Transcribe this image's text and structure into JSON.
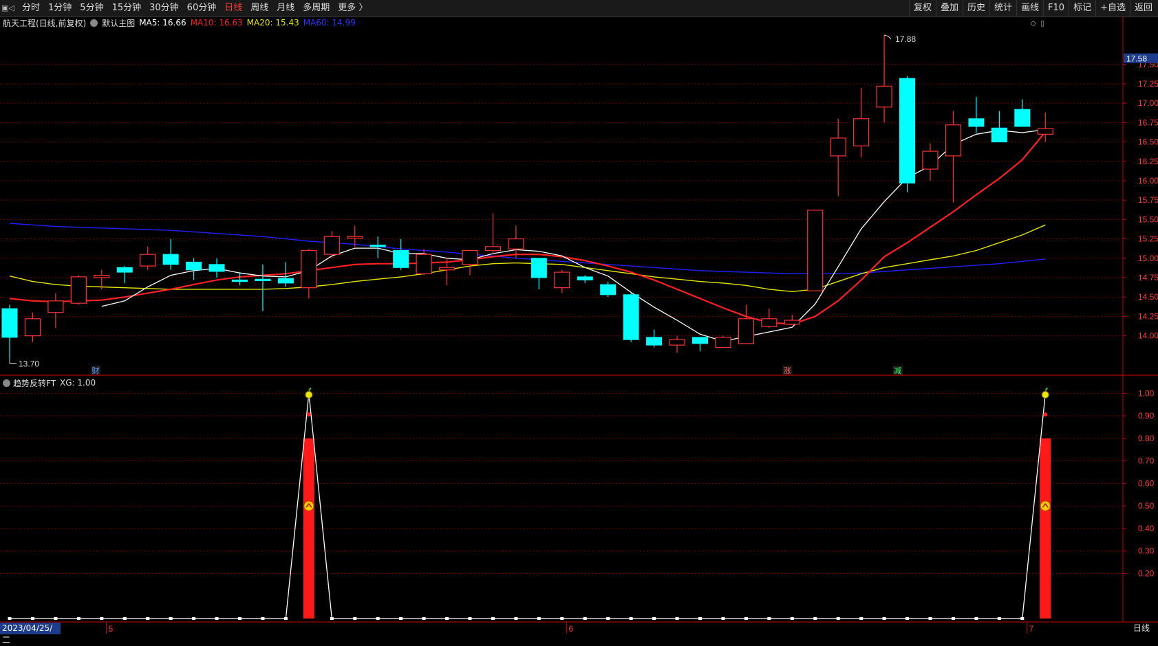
{
  "toolbar": {
    "left_items": [
      "分时",
      "1分钟",
      "5分钟",
      "15分钟",
      "30分钟",
      "60分钟",
      "日线",
      "周线",
      "月线",
      "多周期",
      "更多 〉"
    ],
    "active_index": 6,
    "right_items": [
      "复权",
      "叠加",
      "历史",
      "统计",
      "画线",
      "F10",
      "标记",
      "+自选",
      "返回"
    ]
  },
  "main_chart": {
    "stock_title": "航天工程(日线,前复权)",
    "template_label": "默认主图",
    "ma5": "MA5: 16.66",
    "ma10": "MA10: 16.63",
    "ma20": "MA20: 15.43",
    "ma60": "MA60: 14.99",
    "high_label": "17.88",
    "low_label": "13.70",
    "price_tag": "17.58",
    "marker_cai": "财",
    "marker_zhang": "涨",
    "marker_jian": "减"
  },
  "indicator": {
    "title": "趋势反转FT",
    "xg_value": "XG: 1.00"
  },
  "bottom": {
    "date": "2023/04/25/二",
    "period": "日线",
    "month_ticks": [
      "5",
      "6",
      "7"
    ]
  },
  "colors": {
    "up": "#ff3333",
    "down": "#00ffff",
    "ma5": "#ffffff",
    "ma10": "#ff2020",
    "ma20": "#e6e600",
    "ma60": "#2020ff",
    "grid": "#7a0000",
    "axis": "#c00000",
    "price_tag": "#1e3c8c"
  },
  "chart_data": {
    "type": "candlestick",
    "y_axis_ticks": [
      14.0,
      14.25,
      14.5,
      14.75,
      15.0,
      15.25,
      15.5,
      15.75,
      16.0,
      16.25,
      16.5,
      16.75,
      17.0,
      17.25,
      17.5
    ],
    "ylim": [
      13.5,
      17.95
    ],
    "candles": [
      {
        "o": 14.35,
        "h": 14.4,
        "l": 13.7,
        "c": 13.98
      },
      {
        "o": 14.0,
        "h": 14.3,
        "l": 13.92,
        "c": 14.22
      },
      {
        "o": 14.3,
        "h": 14.55,
        "l": 14.1,
        "c": 14.45
      },
      {
        "o": 14.42,
        "h": 14.78,
        "l": 14.4,
        "c": 14.76
      },
      {
        "o": 14.75,
        "h": 14.85,
        "l": 14.6,
        "c": 14.78
      },
      {
        "o": 14.88,
        "h": 14.9,
        "l": 14.68,
        "c": 14.82
      },
      {
        "o": 14.9,
        "h": 15.15,
        "l": 14.85,
        "c": 15.05
      },
      {
        "o": 15.05,
        "h": 15.25,
        "l": 14.85,
        "c": 14.92
      },
      {
        "o": 14.95,
        "h": 15.0,
        "l": 14.72,
        "c": 14.85
      },
      {
        "o": 14.92,
        "h": 15.0,
        "l": 14.75,
        "c": 14.83
      },
      {
        "o": 14.72,
        "h": 14.82,
        "l": 14.65,
        "c": 14.7
      },
      {
        "o": 14.73,
        "h": 14.92,
        "l": 14.32,
        "c": 14.71
      },
      {
        "o": 14.74,
        "h": 14.95,
        "l": 14.63,
        "c": 14.68
      },
      {
        "o": 14.62,
        "h": 15.12,
        "l": 14.48,
        "c": 15.1
      },
      {
        "o": 15.05,
        "h": 15.35,
        "l": 15.0,
        "c": 15.28
      },
      {
        "o": 15.26,
        "h": 15.42,
        "l": 15.15,
        "c": 15.28
      },
      {
        "o": 15.17,
        "h": 15.28,
        "l": 15.0,
        "c": 15.15
      },
      {
        "o": 15.1,
        "h": 15.25,
        "l": 14.85,
        "c": 14.88
      },
      {
        "o": 14.8,
        "h": 15.12,
        "l": 14.78,
        "c": 15.05
      },
      {
        "o": 14.85,
        "h": 15.0,
        "l": 14.65,
        "c": 14.88
      },
      {
        "o": 14.92,
        "h": 15.1,
        "l": 14.78,
        "c": 15.1
      },
      {
        "o": 15.1,
        "h": 15.58,
        "l": 15.05,
        "c": 15.15
      },
      {
        "o": 15.12,
        "h": 15.42,
        "l": 15.0,
        "c": 15.25
      },
      {
        "o": 15.0,
        "h": 15.0,
        "l": 14.6,
        "c": 14.75
      },
      {
        "o": 14.62,
        "h": 14.85,
        "l": 14.55,
        "c": 14.82
      },
      {
        "o": 14.76,
        "h": 14.78,
        "l": 14.68,
        "c": 14.72
      },
      {
        "o": 14.66,
        "h": 14.7,
        "l": 14.5,
        "c": 14.53
      },
      {
        "o": 14.53,
        "h": 14.55,
        "l": 13.92,
        "c": 13.95
      },
      {
        "o": 13.98,
        "h": 14.08,
        "l": 13.85,
        "c": 13.88
      },
      {
        "o": 13.88,
        "h": 14.0,
        "l": 13.78,
        "c": 13.95
      },
      {
        "o": 13.98,
        "h": 13.98,
        "l": 13.8,
        "c": 13.9
      },
      {
        "o": 13.85,
        "h": 14.0,
        "l": 13.85,
        "c": 13.98
      },
      {
        "o": 13.9,
        "h": 14.4,
        "l": 13.9,
        "c": 14.22
      },
      {
        "o": 14.12,
        "h": 14.35,
        "l": 14.1,
        "c": 14.22
      },
      {
        "o": 14.15,
        "h": 14.27,
        "l": 14.15,
        "c": 14.2
      },
      {
        "o": 14.58,
        "h": 15.62,
        "l": 14.58,
        "c": 15.62
      },
      {
        "o": 16.32,
        "h": 16.8,
        "l": 15.8,
        "c": 16.55
      },
      {
        "o": 16.45,
        "h": 17.2,
        "l": 16.3,
        "c": 16.8
      },
      {
        "o": 16.95,
        "h": 17.88,
        "l": 16.75,
        "c": 17.22
      },
      {
        "o": 17.32,
        "h": 17.35,
        "l": 15.85,
        "c": 15.97
      },
      {
        "o": 16.15,
        "h": 16.48,
        "l": 16.0,
        "c": 16.38
      },
      {
        "o": 16.32,
        "h": 16.9,
        "l": 15.72,
        "c": 16.72
      },
      {
        "o": 16.8,
        "h": 17.08,
        "l": 16.62,
        "c": 16.7
      },
      {
        "o": 16.68,
        "h": 16.9,
        "l": 16.5,
        "c": 16.5
      },
      {
        "o": 16.92,
        "h": 17.05,
        "l": 16.7,
        "c": 16.7
      },
      {
        "o": 16.6,
        "h": 16.88,
        "l": 16.5,
        "c": 16.67
      }
    ],
    "ma5": [
      null,
      null,
      null,
      null,
      14.38,
      14.45,
      14.63,
      14.78,
      14.84,
      14.87,
      14.81,
      14.77,
      14.76,
      14.84,
      15.03,
      15.13,
      15.13,
      15.06,
      15.06,
      15.0,
      14.98,
      15.06,
      15.11,
      15.09,
      15.03,
      14.88,
      14.77,
      14.56,
      14.37,
      14.2,
      14.02,
      13.93,
      13.99,
      14.05,
      14.11,
      14.41,
      14.89,
      15.38,
      15.73,
      16.04,
      16.19,
      16.47,
      16.6,
      16.65,
      16.62,
      16.66
    ],
    "ma10": [
      14.48,
      14.45,
      14.44,
      14.45,
      14.46,
      14.5,
      14.55,
      14.6,
      14.66,
      14.72,
      14.76,
      14.78,
      14.8,
      14.84,
      14.88,
      14.92,
      14.93,
      14.93,
      14.94,
      14.95,
      14.98,
      15.02,
      15.05,
      15.05,
      15.02,
      14.97,
      14.9,
      14.82,
      14.72,
      14.6,
      14.48,
      14.36,
      14.25,
      14.17,
      14.15,
      14.25,
      14.45,
      14.72,
      15.02,
      15.2,
      15.4,
      15.6,
      15.82,
      16.03,
      16.27,
      16.63
    ],
    "ma20": [
      14.77,
      14.7,
      14.66,
      14.64,
      14.63,
      14.62,
      14.61,
      14.6,
      14.6,
      14.6,
      14.6,
      14.6,
      14.61,
      14.63,
      14.66,
      14.7,
      14.73,
      14.76,
      14.8,
      14.85,
      14.9,
      14.93,
      14.94,
      14.93,
      14.92,
      14.88,
      14.84,
      14.8,
      14.76,
      14.73,
      14.7,
      14.68,
      14.65,
      14.6,
      14.57,
      14.6,
      14.7,
      14.8,
      14.88,
      14.93,
      14.98,
      15.03,
      15.1,
      15.2,
      15.3,
      15.43
    ],
    "ma60": [
      15.45,
      15.43,
      15.41,
      15.4,
      15.39,
      15.38,
      15.37,
      15.36,
      15.34,
      15.32,
      15.3,
      15.28,
      15.25,
      15.22,
      15.2,
      15.18,
      15.15,
      15.12,
      15.1,
      15.08,
      15.05,
      15.03,
      15.0,
      14.98,
      14.96,
      14.94,
      14.92,
      14.9,
      14.88,
      14.86,
      14.84,
      14.83,
      14.82,
      14.81,
      14.8,
      14.8,
      14.8,
      14.81,
      14.83,
      14.85,
      14.87,
      14.89,
      14.91,
      14.93,
      14.96,
      14.99
    ],
    "indicator": {
      "y_axis_ticks": [
        0.2,
        0.3,
        0.4,
        0.5,
        0.6,
        0.7,
        0.8,
        0.9,
        1.0
      ],
      "ylim": [
        0,
        1.05
      ],
      "bar_value": 0.8,
      "signal_indices": [
        13,
        45
      ],
      "xg": [
        0,
        0,
        0,
        0,
        0,
        0,
        0,
        0,
        0,
        0,
        0,
        0,
        0,
        1,
        0,
        0,
        0,
        0,
        0,
        0,
        0,
        0,
        0,
        0,
        0,
        0,
        0,
        0,
        0,
        0,
        0,
        0,
        0,
        0,
        0,
        0,
        0,
        0,
        0,
        0,
        0,
        0,
        0,
        0,
        0,
        1
      ]
    }
  }
}
